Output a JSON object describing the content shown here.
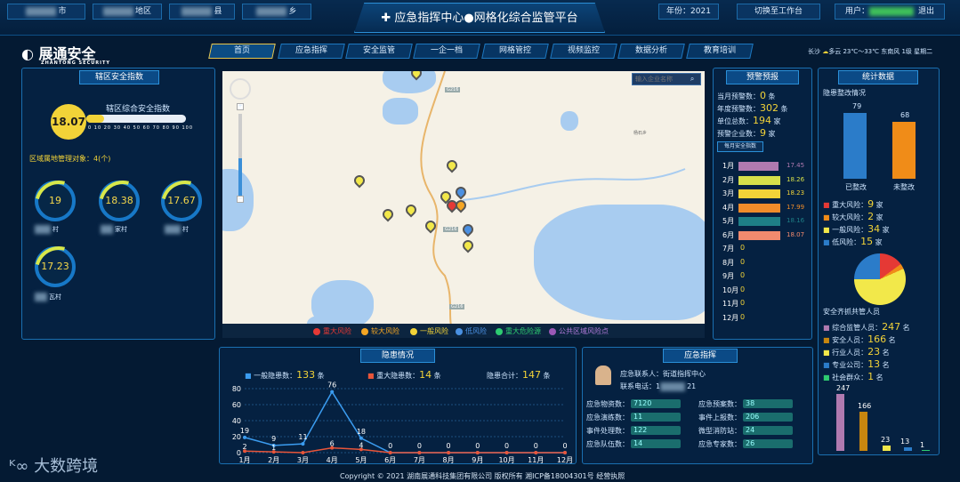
{
  "header": {
    "title": "应急指挥中心●网格化综合监管平台",
    "loc1_suffix": "市",
    "loc2_suffix": "地区",
    "loc3_suffix": "县",
    "loc4_suffix": "乡",
    "year": "年份：2021",
    "switch": "切换至工作台",
    "user_label": "用户：",
    "logout": "退出"
  },
  "brand": {
    "name": "展通安全",
    "sub": "ZHANTONG SECURITY"
  },
  "nav": [
    "首页",
    "应急指挥",
    "安全监管",
    "一企一档",
    "网格管控",
    "视频监控",
    "数据分析",
    "教育培训"
  ],
  "weather": {
    "city": "长沙",
    "temp": "多云 23℃～33℃",
    "wind": "东南风 1级",
    "day": "星期二"
  },
  "left": {
    "title": "辖区安全指数",
    "gauge_label": "辖区综合安全指数",
    "gauge_value": "18.07",
    "ticks": [
      "0",
      "10",
      "20",
      "30",
      "40",
      "50",
      "60",
      "70",
      "80",
      "90",
      "100"
    ],
    "mgmt": "区域属地管理对象：4(个)",
    "villages": [
      {
        "v": "19",
        "n": "村"
      },
      {
        "v": "18.38",
        "n": "家村"
      },
      {
        "v": "17.67",
        "n": "村"
      },
      {
        "v": "17.23",
        "n": "瓦村"
      }
    ]
  },
  "map": {
    "search_placeholder": "输入企业名称",
    "road1": "G216",
    "road2": "G216",
    "road3": "G216",
    "place": "杨石乡",
    "legend": [
      "重大风险",
      "较大风险",
      "一般风险",
      "低风险",
      "重大危险源",
      "公共区域风险点"
    ],
    "legend_colors": [
      "#e53935",
      "#f5a623",
      "#f2d338",
      "#4a90e2",
      "#2ecc71",
      "#9b59b6"
    ]
  },
  "warn": {
    "title": "预警预报",
    "rows": [
      {
        "l": "当月预警数：",
        "v": "0",
        "u": "条"
      },
      {
        "l": "年度预警数：",
        "v": "302",
        "u": "条"
      },
      {
        "l": "单位总数：",
        "v": "194",
        "u": "家"
      },
      {
        "l": "预警企业数：",
        "v": "9",
        "u": "家"
      }
    ],
    "btn": "每月安全指数",
    "months": [
      {
        "m": "1月",
        "v": "17.45",
        "c": "#b07ab0",
        "f": 0.72
      },
      {
        "m": "2月",
        "v": "18.26",
        "c": "#d6e04a",
        "f": 0.76
      },
      {
        "m": "3月",
        "v": "18.23",
        "c": "#f2d338",
        "f": 0.76
      },
      {
        "m": "4月",
        "v": "17.99",
        "c": "#f08c2a",
        "f": 0.75
      },
      {
        "m": "5月",
        "v": "18.16",
        "c": "#1e7f86",
        "f": 0.75
      },
      {
        "m": "6月",
        "v": "18.07",
        "c": "#f28a6e",
        "f": 0.75
      },
      {
        "m": "7月",
        "v": "0",
        "c": "",
        "f": 0
      },
      {
        "m": "8月",
        "v": "0",
        "c": "",
        "f": 0
      },
      {
        "m": "9月",
        "v": "0",
        "c": "",
        "f": 0
      },
      {
        "m": "10月",
        "v": "0",
        "c": "",
        "f": 0
      },
      {
        "m": "11月",
        "v": "0",
        "c": "",
        "f": 0
      },
      {
        "m": "12月",
        "v": "0",
        "c": "",
        "f": 0
      }
    ]
  },
  "stats": {
    "title": "统计数据",
    "sub": "隐患整改情况",
    "bars": [
      {
        "v": "79",
        "l": "已整改",
        "c": "#2b7cc9"
      },
      {
        "v": "68",
        "l": "未整改",
        "c": "#f08c18"
      }
    ],
    "risks": [
      {
        "l": "重大风险：",
        "v": "9",
        "u": "家",
        "c": "#e53935"
      },
      {
        "l": "较大风险：",
        "v": "2",
        "u": "家",
        "c": "#f08c18"
      },
      {
        "l": "一般风险：",
        "v": "34",
        "u": "家",
        "c": "#f2e84a"
      },
      {
        "l": "低风险：",
        "v": "15",
        "u": "家",
        "c": "#2b7cc9"
      }
    ],
    "staff_title": "安全齐抓共管人员",
    "staff": [
      {
        "l": "综合监管人员：",
        "v": "247",
        "u": "名",
        "c": "#b07ab0"
      },
      {
        "l": "安全人员：",
        "v": "166",
        "u": "名",
        "c": "#c8860f"
      },
      {
        "l": "行业人员：",
        "v": "23",
        "u": "名",
        "c": "#f2e84a"
      },
      {
        "l": "专业公司：",
        "v": "13",
        "u": "名",
        "c": "#2b7cc9"
      },
      {
        "l": "社会群众：",
        "v": "1",
        "u": "名",
        "c": "#2ecc71"
      }
    ]
  },
  "hazard": {
    "title": "隐患情况",
    "general_l": "一般隐患数：",
    "general_v": "133",
    "general_u": "条",
    "major_l": "重大隐患数：",
    "major_v": "14",
    "major_u": "条",
    "total_l": "隐患合计：",
    "total_v": "147",
    "total_u": "条"
  },
  "emergency": {
    "title": "应急指挥",
    "contact_l": "应急联系人：",
    "contact_v": "街道指挥中心",
    "phone_l": "联系电话：",
    "phone_v": "1",
    "phone_tail": "21",
    "items": [
      {
        "l": "应急物资数：",
        "v": "7120"
      },
      {
        "l": "应急预案数：",
        "v": "38"
      },
      {
        "l": "应急演练数：",
        "v": "11"
      },
      {
        "l": "事件上报数：",
        "v": "206"
      },
      {
        "l": "事件处理数：",
        "v": "122"
      },
      {
        "l": "微型消防站：",
        "v": "24"
      },
      {
        "l": "应急队伍数：",
        "v": "14"
      },
      {
        "l": "应急专家数：",
        "v": "26"
      }
    ]
  },
  "footer": "Copyright © 2021 湖南展通科技集团有限公司 版权所有 湘ICP备18004301号 经营执照",
  "watermark": "大数跨境",
  "chart_data": {
    "type": "line",
    "categories": [
      "1月",
      "2月",
      "3月",
      "4月",
      "5月",
      "6月",
      "7月",
      "8月",
      "9月",
      "10月",
      "11月",
      "12月"
    ],
    "series": [
      {
        "name": "一般隐患数",
        "values": [
          19,
          9,
          11,
          76,
          18,
          0,
          0,
          0,
          0,
          0,
          0,
          0
        ]
      },
      {
        "name": "重大隐患数",
        "values": [
          2,
          1,
          0,
          6,
          4,
          0,
          0,
          0,
          0,
          0,
          0,
          0
        ]
      }
    ],
    "ylim": [
      0,
      80
    ],
    "yticks": [
      0,
      20,
      40,
      60,
      80
    ]
  }
}
